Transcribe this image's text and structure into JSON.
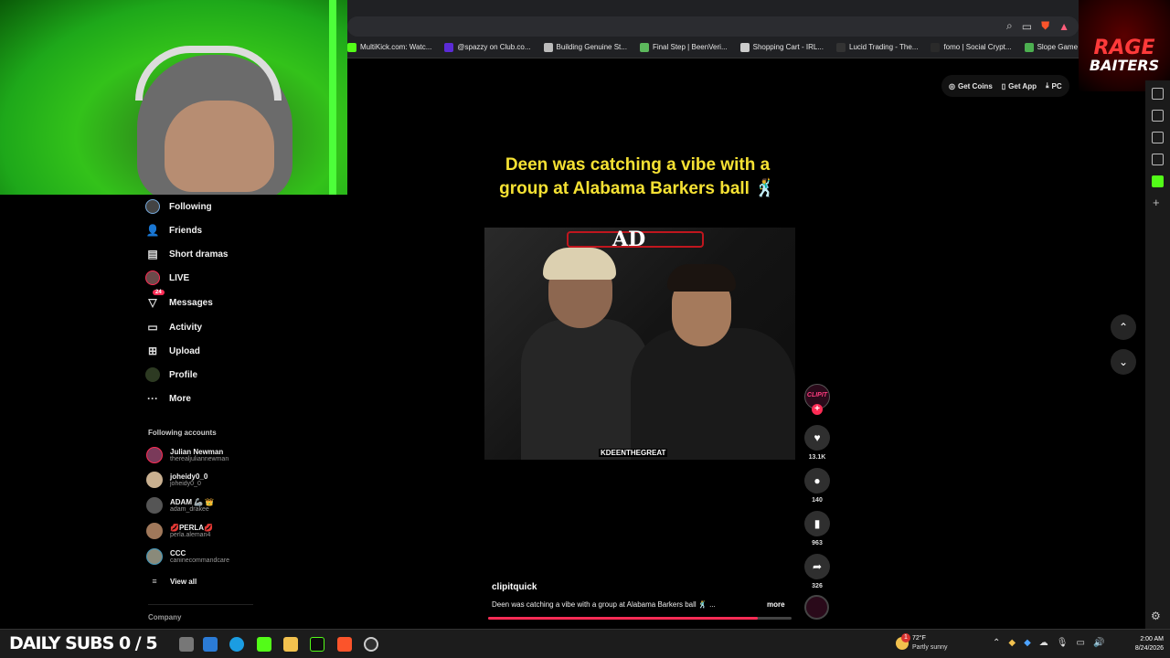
{
  "browser": {
    "bookmarks": [
      {
        "label": "MultiKick.com: Watc...",
        "color": "#53fc18"
      },
      {
        "label": "@spazzy on Club.co...",
        "color": "#5b2bd6"
      },
      {
        "label": "Building Genuine St...",
        "color": "#bbbbbb"
      },
      {
        "label": "Final Step | BeenVeri...",
        "color": "#5cb85c"
      },
      {
        "label": "Shopping Cart - IRL...",
        "color": "#cccccc"
      },
      {
        "label": "Lucid Trading - The...",
        "color": "#333333"
      },
      {
        "label": "fomo | Social Crypt...",
        "color": "#2a2a2a"
      },
      {
        "label": "Slope Game",
        "color": "#4caf50"
      }
    ]
  },
  "overlay": {
    "logo_line1": "RAGE",
    "logo_line2": "BAITERS",
    "daily_subs": "DAILY SUBS 0 / 5"
  },
  "sidebar": {
    "items": [
      {
        "label": "Following",
        "icon": "following-avatar-icon"
      },
      {
        "label": "Friends",
        "icon": "friends-icon"
      },
      {
        "label": "Short dramas",
        "icon": "short-dramas-icon"
      },
      {
        "label": "LIVE",
        "icon": "live-icon"
      },
      {
        "label": "Messages",
        "icon": "messages-icon",
        "badge": "24"
      },
      {
        "label": "Activity",
        "icon": "activity-icon"
      },
      {
        "label": "Upload",
        "icon": "upload-icon"
      },
      {
        "label": "Profile",
        "icon": "profile-avatar-icon"
      },
      {
        "label": "More",
        "icon": "more-icon"
      }
    ],
    "following_title": "Following accounts",
    "accounts": [
      {
        "name": "Julian Newman",
        "handle": "therealjuliannewman"
      },
      {
        "name": "joheidy0_0",
        "handle": "joheidy0_0"
      },
      {
        "name": "ADAM 🦾 👑",
        "handle": "adam_drakee"
      },
      {
        "name": "💋PERLA💋",
        "handle": "perla.aleman4"
      },
      {
        "name": "CCC",
        "handle": "caninecommandcare"
      }
    ],
    "view_all": "View all",
    "company": "Company"
  },
  "top_actions": {
    "get_coins": "Get Coins",
    "get_app": "Get App",
    "pc": "PC"
  },
  "video": {
    "caption": "Deen was catching a vibe with a group at Alabama Barkers ball 🕺",
    "overlay_logo": "AD",
    "watermark": "KDEENTHEGREAT",
    "author": "clipitquick",
    "author_avatar_text": "CLIPIT",
    "description": "Deen was catching a vibe with a group at Alabama Barkers ball 🕺 ...",
    "more": "more",
    "progress": 0.89,
    "likes": "13.1K",
    "comments": "140",
    "saves": "963",
    "shares": "326"
  },
  "taskbar": {
    "weather_temp": "72°F",
    "weather_desc": "Partly sunny",
    "weather_badge": "1",
    "time": "2:00 AM",
    "date": "8/24/2026"
  }
}
